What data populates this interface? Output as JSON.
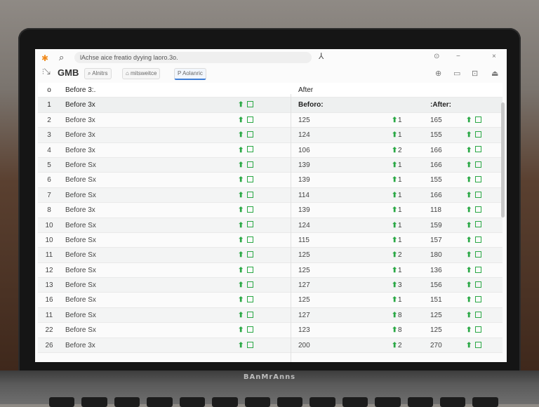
{
  "titlebar": {
    "address": "lAchse aice  freatio dyying laoro.3o.",
    "controls": [
      "⊙",
      "−",
      "×"
    ]
  },
  "toolbar": {
    "app_name": "GMB",
    "chips": [
      {
        "label": "⌕ Alnitrs"
      },
      {
        "label": "⌂ mitsweitce"
      },
      {
        "label": "P  Aolanric"
      }
    ]
  },
  "table": {
    "header": {
      "num": "o",
      "before": "Before 3:.",
      "after": "After"
    },
    "subheader": {
      "num": "1",
      "before_label": "Before 3x",
      "col_b": "Beforo:",
      "col_a": ":After:"
    },
    "rows": [
      {
        "num": "2",
        "name": "Before 3x",
        "b": "125",
        "delta": "1",
        "a": "165"
      },
      {
        "num": "3",
        "name": "Before 3x",
        "b": "124",
        "delta": "1",
        "a": "155"
      },
      {
        "num": "4",
        "name": "Before 3x",
        "b": "106",
        "delta": "2",
        "a": "166"
      },
      {
        "num": "5",
        "name": "Before Sx",
        "b": "139",
        "delta": "1",
        "a": "166"
      },
      {
        "num": "6",
        "name": "Before Sx",
        "b": "139",
        "delta": "1",
        "a": "155"
      },
      {
        "num": "7",
        "name": "Before Sx",
        "b": "114",
        "delta": "1",
        "a": "166"
      },
      {
        "num": "8",
        "name": "Before 3x",
        "b": "139",
        "delta": "1",
        "a": "118"
      },
      {
        "num": "10",
        "name": "Before Sx",
        "b": "124",
        "delta": "1",
        "a": "159"
      },
      {
        "num": "10",
        "name": "Before Sx",
        "b": "115",
        "delta": "1",
        "a": "157"
      },
      {
        "num": "11",
        "name": "Before Sx",
        "b": "125",
        "delta": "2",
        "a": "180"
      },
      {
        "num": "12",
        "name": "Before Sx",
        "b": "125",
        "delta": "1",
        "a": "136"
      },
      {
        "num": "13",
        "name": "Before Sx",
        "b": "127",
        "delta": "3",
        "a": "156"
      },
      {
        "num": "16",
        "name": "Before Sx",
        "b": "125",
        "delta": "1",
        "a": "151"
      },
      {
        "num": "11",
        "name": "Before Sx",
        "b": "127",
        "delta": "8",
        "a": "125"
      },
      {
        "num": "22",
        "name": "Before Sx",
        "b": "123",
        "delta": "8",
        "a": "125"
      },
      {
        "num": "26",
        "name": "Before 3x",
        "b": "200",
        "delta": "2",
        "a": "270"
      }
    ]
  },
  "laptop": {
    "brand": "BAnMrAnns"
  },
  "colors": {
    "accent_green": "#2aa845",
    "accent_blue": "#3d7dd6",
    "app_orange": "#f08a1c"
  },
  "icons": {
    "arrow": "up-arrow-icon",
    "box": "checkbox-icon"
  }
}
